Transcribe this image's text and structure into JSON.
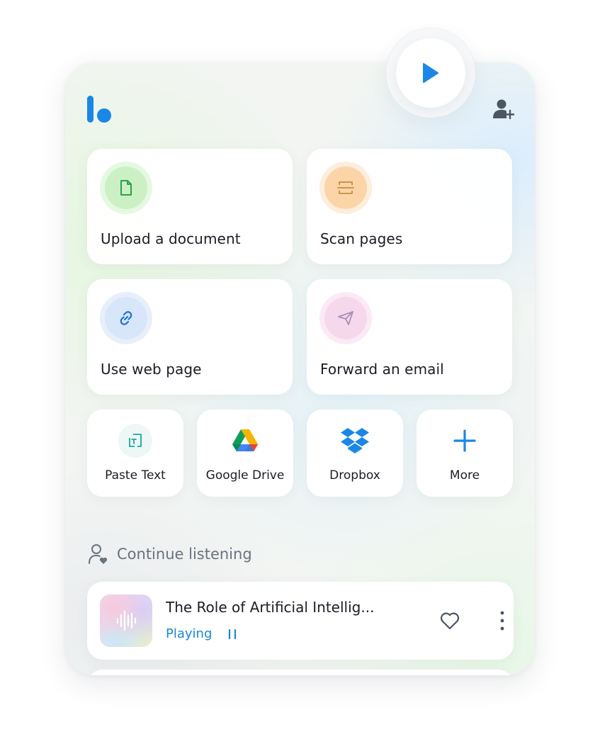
{
  "actions": {
    "upload_document": "Upload a document",
    "scan_pages": "Scan pages",
    "use_web_page": "Use web page",
    "forward_email": "Forward an email"
  },
  "sources": {
    "paste_text": "Paste Text",
    "google_drive": "Google Drive",
    "dropbox": "Dropbox",
    "more": "More"
  },
  "continue_listening": {
    "title": "Continue listening",
    "items": [
      {
        "title": "The Role of Artificial Intellig...",
        "status": "Playing"
      }
    ]
  },
  "icons": {
    "play": "play-icon",
    "logo": "logo-icon",
    "add_user": "add-user-icon",
    "upload": "document-icon",
    "scan": "scan-icon",
    "web": "link-icon",
    "email": "send-icon",
    "paste": "paste-text-icon",
    "drive": "google-drive-icon",
    "dropbox": "dropbox-icon",
    "more": "plus-icon",
    "listen": "user-heart-icon",
    "waveform": "waveform-icon",
    "pause": "pause-icon",
    "heart": "heart-icon",
    "kebab": "kebab-icon"
  },
  "colors": {
    "brand": "#1a87e6",
    "upload_ring": "#dff7dc",
    "scan_ring": "#fde7cc",
    "web_ring": "#dde9fb",
    "email_ring": "#f8e0f0",
    "status": "#1a87d6"
  }
}
